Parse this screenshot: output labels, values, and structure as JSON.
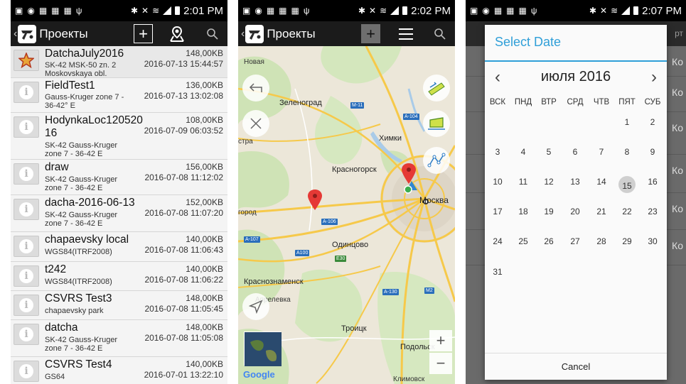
{
  "status": {
    "panel1_time": "2:01 PM",
    "panel2_time": "2:02 PM",
    "panel3_time": "2:07 PM"
  },
  "actionbar": {
    "title": "Проекты"
  },
  "projects": [
    {
      "name": "DatchaJuly2016",
      "sub": "SK-42 MSK-50 zn. 2 Moskovskaya obl.",
      "size": "148,00KB",
      "date": "2016-07-13 15:44:57",
      "icon": "star-icon"
    },
    {
      "name": "FieldTest1",
      "sub": "Gauss-Kruger zone 7 - 36-42° E",
      "size": "136,00KB",
      "date": "2016-07-13 13:02:08",
      "icon": "info-icon"
    },
    {
      "name": "HodynkaLoc12052016",
      "sub": "SK-42 Gauss-Kruger zone 7 - 36-42 E",
      "size": "108,00KB",
      "date": "2016-07-09 06:03:52",
      "icon": "info-icon"
    },
    {
      "name": "draw",
      "sub": "SK-42 Gauss-Kruger zone 7 - 36-42 E",
      "size": "156,00KB",
      "date": "2016-07-08 11:12:02",
      "icon": "info-icon"
    },
    {
      "name": "dacha-2016-06-13",
      "sub": "SK-42 Gauss-Kruger zone 7 - 36-42 E",
      "size": "152,00KB",
      "date": "2016-07-08 11:07:20",
      "icon": "info-icon"
    },
    {
      "name": "chapaevsky local",
      "sub": "WGS84(ITRF2008)",
      "size": "140,00KB",
      "date": "2016-07-08 11:06:43",
      "icon": "info-icon"
    },
    {
      "name": "t242",
      "sub": "WGS84(ITRF2008)",
      "size": "140,00KB",
      "date": "2016-07-08 11:06:22",
      "icon": "info-icon"
    },
    {
      "name": "CSVRS Test3",
      "sub": "chapaevsky park",
      "size": "148,00KB",
      "date": "2016-07-08 11:05:45",
      "icon": "info-icon"
    },
    {
      "name": "datcha",
      "sub": "SK-42 Gauss-Kruger zone 7 - 36-42 E",
      "size": "148,00KB",
      "date": "2016-07-08 11:05:08",
      "icon": "info-icon"
    },
    {
      "name": "CSVRS Test4",
      "sub": "GS64",
      "size": "140,00KB",
      "date": "2016-07-01 13:22:10",
      "icon": "info-icon"
    }
  ],
  "map": {
    "labels": {
      "novaya": "Новая",
      "zelenograd": "Зеленоград",
      "khimki": "Химки",
      "krasnogorsk": "Красногорск",
      "moskva": "Москва",
      "odintsovo": "Одинцово",
      "krasnoznamensk": "Краснознаменск",
      "aprelevka": "Апрелевка",
      "troitsk": "Троицк",
      "podolsk": "Подольск",
      "klimovsk": "Климовск",
      "stra": "стра",
      "gorod": "город"
    },
    "shields": {
      "m11": "M-11",
      "a104": "A-104",
      "a106": "A-106",
      "a107": "A-107",
      "a100": "A100",
      "e30": "E30",
      "a130": "A-130",
      "m2": "M2"
    },
    "attribution": "Google"
  },
  "dialog": {
    "title": "Select Date",
    "month": "июля 2016",
    "weekdays": [
      "ВСК",
      "ПНД",
      "ВТР",
      "СРД",
      "ЧТВ",
      "ПЯТ",
      "СУБ"
    ],
    "days": [
      "1",
      "2",
      "3",
      "4",
      "5",
      "6",
      "7",
      "8",
      "9",
      "10",
      "11",
      "12",
      "13",
      "14",
      "15",
      "16",
      "17",
      "18",
      "19",
      "20",
      "21",
      "22",
      "23",
      "24",
      "25",
      "26",
      "27",
      "28",
      "29",
      "30",
      "31"
    ],
    "selected_day": "15",
    "cancel": "Cancel",
    "bg_label": "Ко",
    "bg_header": "рт"
  }
}
